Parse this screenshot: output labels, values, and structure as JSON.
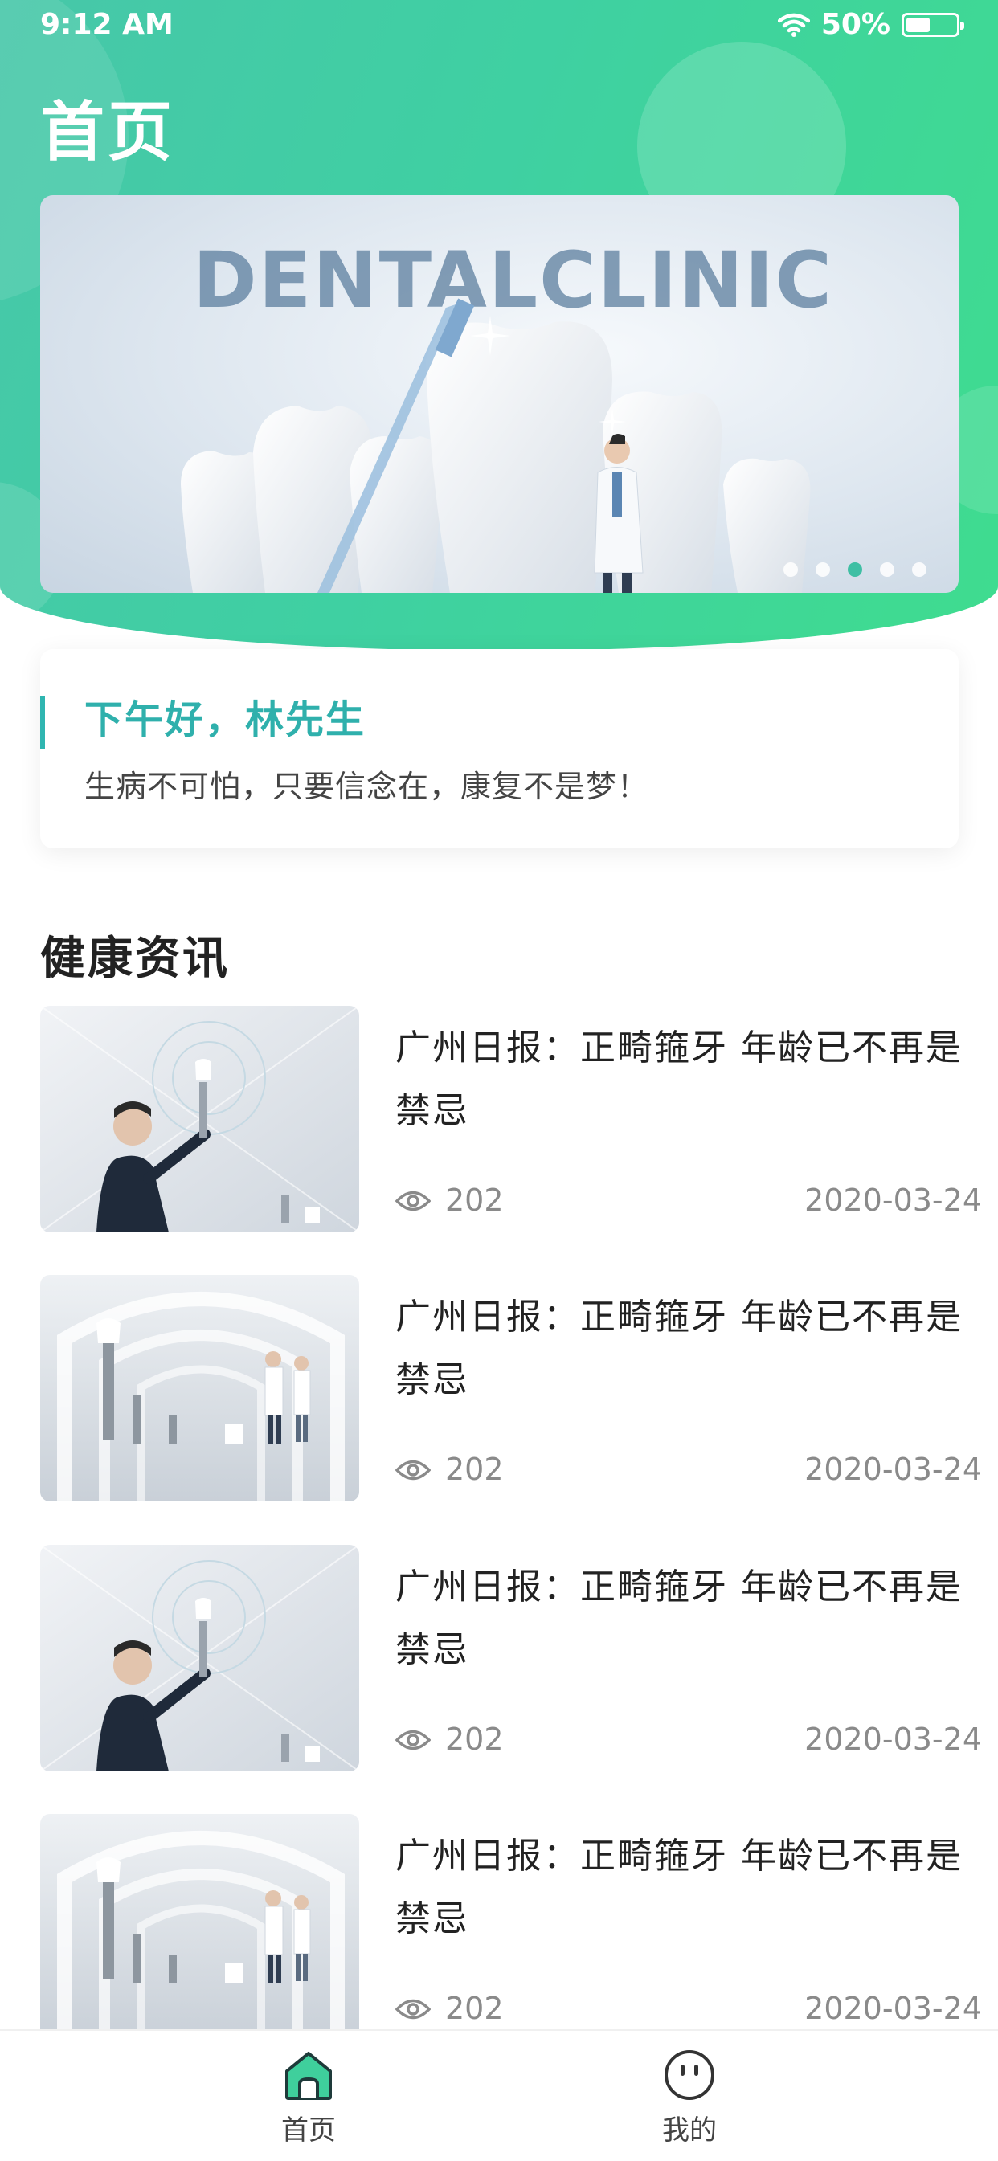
{
  "status_bar": {
    "time": "9:12 AM",
    "battery": "50%",
    "battery_level": 0.5
  },
  "page_title": "首页",
  "banner": {
    "headline": "DENTALCLINIC",
    "slide_count": 5,
    "active_slide": 2
  },
  "greeting": {
    "title": "下午好，林先生",
    "subtitle": "生病不可怕，只要信念在，康复不是梦！"
  },
  "news_section": {
    "title": "健康资讯",
    "items": [
      {
        "title": "广州日报：正畸箍牙 年龄已不再是禁忌",
        "views": "202",
        "date": "2020-03-24",
        "thumb": "businessman-implant"
      },
      {
        "title": "广州日报：正畸箍牙 年龄已不再是禁忌",
        "views": "202",
        "date": "2020-03-24",
        "thumb": "doctors-implants"
      },
      {
        "title": "广州日报：正畸箍牙 年龄已不再是禁忌",
        "views": "202",
        "date": "2020-03-24",
        "thumb": "businessman-implant"
      },
      {
        "title": "广州日报：正畸箍牙 年龄已不再是禁忌",
        "views": "202",
        "date": "2020-03-24",
        "thumb": "doctors-implants"
      }
    ]
  },
  "tab_bar": {
    "tabs": [
      {
        "label": "首页",
        "icon": "home-icon",
        "active": true
      },
      {
        "label": "我的",
        "icon": "face-icon",
        "active": false
      }
    ]
  },
  "colors": {
    "accent": "#2fb0ac",
    "header_start": "#47c7a9",
    "header_end": "#3fdc8f",
    "muted": "#8a8a8a"
  }
}
